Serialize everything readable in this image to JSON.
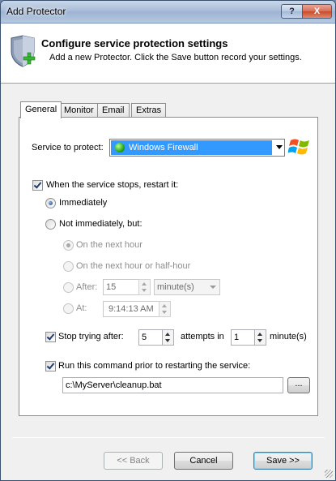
{
  "window": {
    "title": "Add Protector",
    "help_glyph": "?",
    "close_glyph": "X"
  },
  "header": {
    "title": "Configure service protection settings",
    "subtitle": "Add a new Protector. Click the Save button record your settings.",
    "icon": "shield-add-icon"
  },
  "tabs": [
    {
      "label": "General",
      "active": true
    },
    {
      "label": "Monitor",
      "active": false
    },
    {
      "label": "Email",
      "active": false
    },
    {
      "label": "Extras",
      "active": false
    }
  ],
  "general": {
    "service_label": "Service to protect:",
    "service_value": "Windows Firewall",
    "restart_checkbox_label": "When the service stops, restart it:",
    "restart_checked": true,
    "immediately_label": "Immediately",
    "immediately_selected": true,
    "not_immediately_label": "Not immediately, but:",
    "next_hour_label": "On the next hour",
    "next_half_hour_label": "On the next hour or half-hour",
    "after_label": "After:",
    "after_value": "15",
    "after_unit": "minute(s)",
    "at_label": "At:",
    "at_value": "9:14:13 AM",
    "stop_trying_label": "Stop trying after:",
    "stop_trying_checked": true,
    "stop_trying_value": "5",
    "attempts_in_label": "attempts in",
    "attempts_in_value": "1",
    "minutes_label": "minute(s)",
    "run_command_label": "Run this command prior to restarting the service:",
    "run_command_checked": true,
    "command_value": "c:\\MyServer\\cleanup.bat",
    "browse_label": "..."
  },
  "footer": {
    "back_label": "<< Back",
    "cancel_label": "Cancel",
    "save_label": "Save >>"
  },
  "colors": {
    "selection": "#3399ff",
    "titlebar": "#a9bdd8"
  }
}
